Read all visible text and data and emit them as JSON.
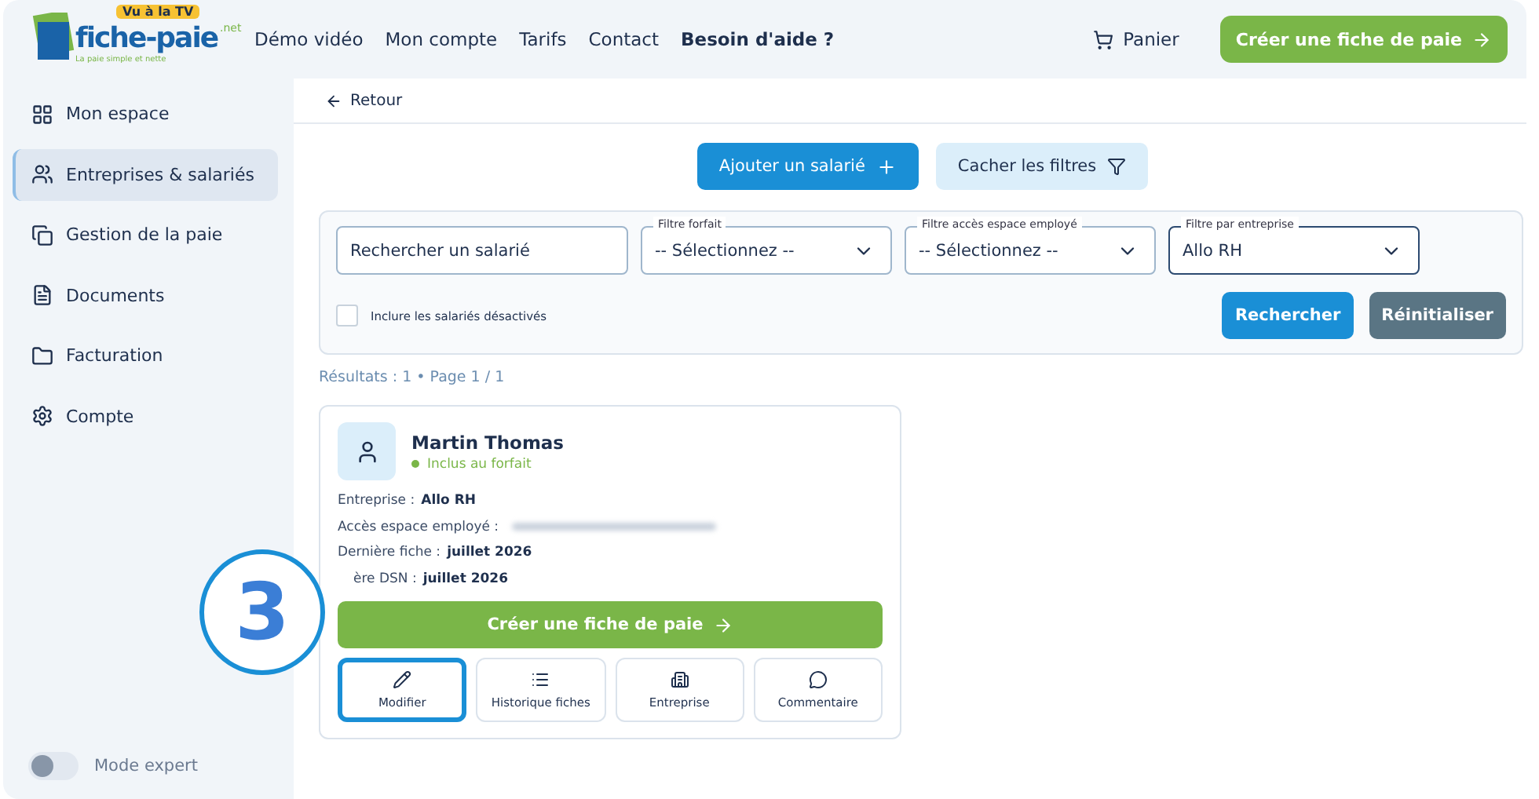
{
  "header": {
    "logo": {
      "badge": "Vu à la TV",
      "name": "fiche-paie",
      "suffix": ".net",
      "tagline": "La paie simple et nette"
    },
    "nav": [
      {
        "label": "Démo vidéo",
        "bold": false
      },
      {
        "label": "Mon compte",
        "bold": false
      },
      {
        "label": "Tarifs",
        "bold": false
      },
      {
        "label": "Contact",
        "bold": false
      },
      {
        "label": "Besoin d'aide ?",
        "bold": true
      }
    ],
    "cart": "Panier",
    "cta": "Créer une fiche de paie"
  },
  "sidebar": {
    "items": [
      {
        "label": "Mon espace",
        "selected": false
      },
      {
        "label": "Entreprises & salariés",
        "selected": true
      },
      {
        "label": "Gestion de la paie",
        "selected": false
      },
      {
        "label": "Documents",
        "selected": false
      },
      {
        "label": "Facturation",
        "selected": false
      },
      {
        "label": "Compte",
        "selected": false
      }
    ],
    "expert_toggle": {
      "label": "Mode expert",
      "on": false
    }
  },
  "main": {
    "back": "Retour",
    "top_buttons": [
      {
        "label": "Ajouter un salarié",
        "kind": "primary"
      },
      {
        "label": "Cacher les filtres",
        "kind": "secondary"
      }
    ],
    "filters": {
      "search": {
        "placeholder": "Rechercher un salarié"
      },
      "selects": [
        {
          "label": "Filtre forfait",
          "value": "-- Sélectionnez --",
          "focused": false
        },
        {
          "label": "Filtre accès espace employé",
          "value": "-- Sélectionnez --",
          "focused": false
        },
        {
          "label": "Filtre par entreprise",
          "value": "Allo RH",
          "focused": true
        }
      ],
      "include_disabled": {
        "label": "Inclure les salariés désactivés",
        "checked": false
      },
      "buttons": [
        {
          "label": "Rechercher",
          "kind": "primary"
        },
        {
          "label": "Réinitialiser",
          "kind": "neutral"
        }
      ]
    },
    "results": "Résultats : 1 • Page 1 / 1",
    "card": {
      "name": "Martin Thomas",
      "status": "Inclus au forfait",
      "fields": [
        {
          "label": "Entreprise :",
          "value": "Allo RH",
          "kind": "text"
        },
        {
          "label": "Accès espace employé :",
          "kind": "blurred"
        },
        {
          "label": "Dernière fiche :",
          "value": "juillet 2026",
          "kind": "text"
        },
        {
          "label": "ère DSN :",
          "value": "juillet 2026",
          "kind": "text"
        }
      ],
      "cta": "Créer une fiche de paie",
      "actions": [
        {
          "label": "Modifier",
          "highlighted": true
        },
        {
          "label": "Historique fiches",
          "highlighted": false
        },
        {
          "label": "Entreprise",
          "highlighted": false
        },
        {
          "label": "Commentaire",
          "highlighted": false
        }
      ]
    },
    "step_badge": "3"
  }
}
